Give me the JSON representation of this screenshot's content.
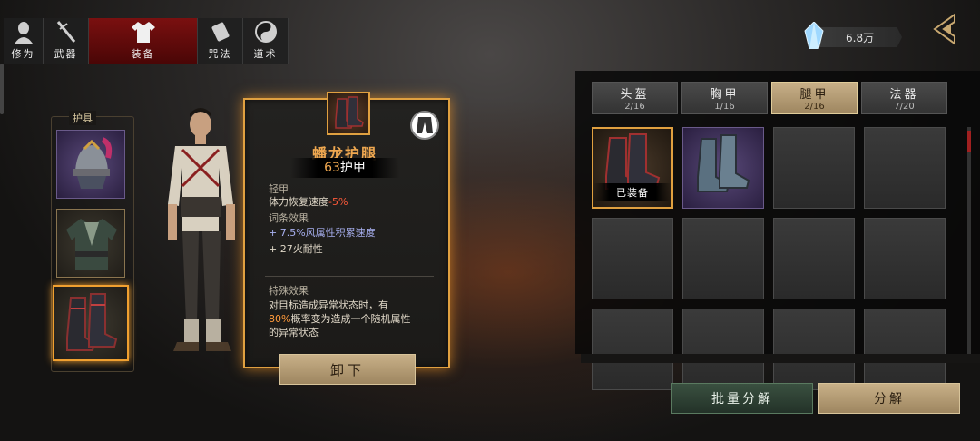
{
  "top_tabs": [
    {
      "label": "修为",
      "icon": "cultivation-head-icon"
    },
    {
      "label": "武器",
      "icon": "sword-icon"
    },
    {
      "label": "装备",
      "icon": "robe-icon",
      "active": true
    },
    {
      "label": "咒法",
      "icon": "scroll-icon"
    },
    {
      "label": "道术",
      "icon": "taiji-icon"
    }
  ],
  "currency": {
    "value": "6.8万",
    "icon": "crystal-icon"
  },
  "equip_slots": {
    "title": "护具"
  },
  "item_card": {
    "name": "蟠龙护腿",
    "armor_value": "63",
    "armor_label": "护甲",
    "type": "轻甲",
    "base_stat_prefix": "体力恢复速度",
    "base_stat_value": "-5%",
    "affix_title": "词条效果",
    "affixes": [
      "+ 7.5%风属性积累速度",
      "+ 27火耐性"
    ],
    "special_title": "特殊效果",
    "special_line1": "对目标造成异常状态时，有",
    "special_percent": "80%",
    "special_line2_rest": "概率变为造成一个随机属性",
    "special_line3": "的异常状态",
    "unequip_label": "卸下"
  },
  "categories": [
    {
      "name": "头盔",
      "count": "2/16"
    },
    {
      "name": "胸甲",
      "count": "1/16"
    },
    {
      "name": "腿甲",
      "count": "2/16",
      "active": true
    },
    {
      "name": "法器",
      "count": "7/20"
    }
  ],
  "inventory": {
    "equipped_tag": "已装备"
  },
  "buttons": {
    "batch_decompose": "批量分解",
    "decompose": "分解"
  },
  "colors": {
    "accent_gold": "#e0a040",
    "active_tab_red": "#7a1010",
    "rare_purple": "#5a4a7a",
    "stat_red": "#ff5a3a"
  }
}
